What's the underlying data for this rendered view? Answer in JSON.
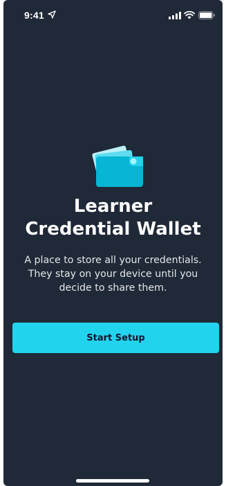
{
  "status_bar": {
    "time": "9:41",
    "icons": [
      "location-arrow-icon",
      "cellular-signal-icon",
      "wifi-icon",
      "battery-icon"
    ]
  },
  "hero": {
    "icon": "wallet-cards-icon",
    "title": "Learner\nCredential Wallet",
    "subtitle": "A place to store all your credentials. They stay on your device until you decide to share them."
  },
  "actions": {
    "start_label": "Start Setup"
  },
  "colors": {
    "background": "#1f2937",
    "accent": "#22d3ee",
    "button_text": "#0f172a",
    "text": "#ffffff"
  }
}
